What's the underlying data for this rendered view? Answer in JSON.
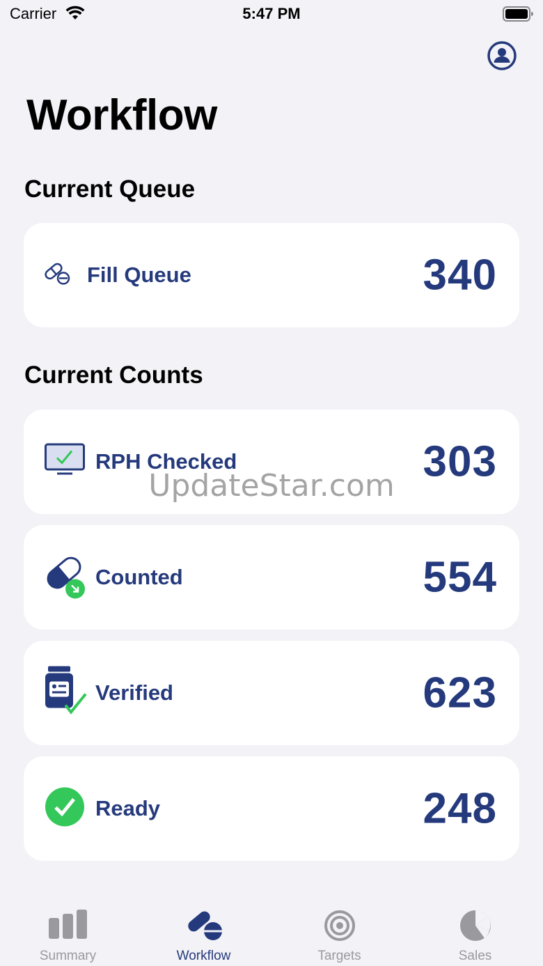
{
  "status_bar": {
    "carrier": "Carrier",
    "time": "5:47 PM"
  },
  "page_title": "Workflow",
  "sections": {
    "queue_title": "Current Queue",
    "counts_title": "Current Counts"
  },
  "queue": {
    "label": "Fill Queue",
    "value": "340",
    "icon": "pill-icon"
  },
  "counts": [
    {
      "label": "RPH Checked",
      "value": "303",
      "icon": "monitor-check-icon"
    },
    {
      "label": "Counted",
      "value": "554",
      "icon": "capsule-arrow-icon"
    },
    {
      "label": "Verified",
      "value": "623",
      "icon": "bottle-check-icon"
    },
    {
      "label": "Ready",
      "value": "248",
      "icon": "check-circle-icon"
    }
  ],
  "watermark": "UpdateStar.com",
  "tabs": [
    {
      "label": "Summary",
      "icon": "bar-chart-icon",
      "active": false
    },
    {
      "label": "Workflow",
      "icon": "pills-icon",
      "active": true
    },
    {
      "label": "Targets",
      "icon": "target-icon",
      "active": false
    },
    {
      "label": "Sales",
      "icon": "pie-chart-icon",
      "active": false
    }
  ],
  "colors": {
    "accent": "#253a7c",
    "success": "#34c759",
    "background": "#f2f2f7",
    "card": "#ffffff",
    "inactive": "#9a9a9e"
  }
}
